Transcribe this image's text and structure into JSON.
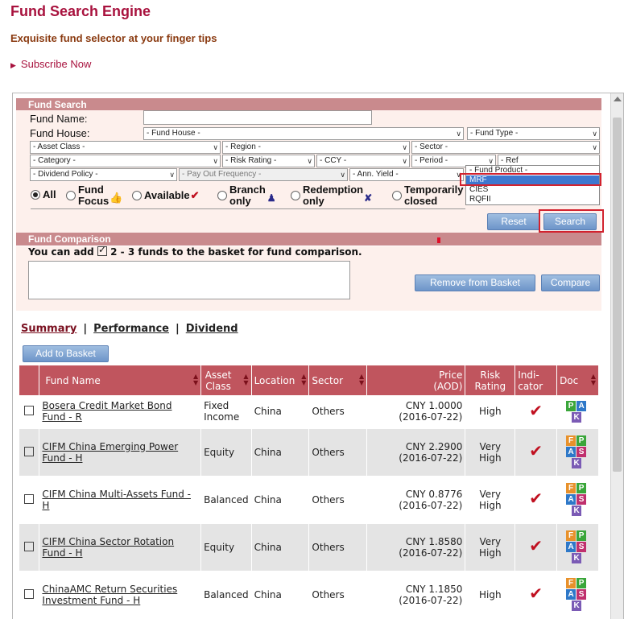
{
  "header": {
    "title": "Fund Search Engine",
    "subtitle": "Exquisite fund selector at your finger tips",
    "subscribe": "Subscribe Now"
  },
  "fund_search": {
    "heading": "Fund Search",
    "fund_name_label": "Fund Name:",
    "fund_house_label": "Fund House:",
    "fund_house_select": "- Fund House -",
    "fund_type_select": "- Fund Type -",
    "asset_class_select": "- Asset Class -",
    "region_select": "- Region -",
    "sector_select": "- Sector -",
    "category_select": "- Category -",
    "risk_rating_select": "- Risk Rating -",
    "ccy_select": "- CCY -",
    "period_select": "- Period -",
    "ref_select": "- Ref",
    "dividend_policy_select": "- Dividend Policy -",
    "payout_frequency_select": "- Pay Out Frequency -",
    "ann_yield_select": "- Ann. Yield -",
    "fund_product_dropdown": {
      "options": [
        "- Fund Product -",
        "MRF",
        "CIES",
        "RQFII"
      ],
      "highlighted": "MRF"
    },
    "radio_options": [
      {
        "label_line1": "All",
        "label_line2": "",
        "selected": true
      },
      {
        "label_line1": "Fund",
        "label_line2": "Focus",
        "selected": false
      },
      {
        "label_line1": "Available",
        "label_line2": "",
        "selected": false
      },
      {
        "label_line1": "Branch",
        "label_line2": "only",
        "selected": false
      },
      {
        "label_line1": "Redemption",
        "label_line2": "only",
        "selected": false
      },
      {
        "label_line1": "Temporarily",
        "label_line2": "closed",
        "selected": false
      }
    ],
    "reset_label": "Reset",
    "search_label": "Search"
  },
  "fund_comparison": {
    "heading": "Fund Comparison",
    "note_prefix": "You can add",
    "note_suffix": "2 - 3 funds to the basket for fund comparison.",
    "remove_label": "Remove from Basket",
    "compare_label": "Compare"
  },
  "tabs": [
    "Summary",
    "Performance",
    "Dividend"
  ],
  "add_to_basket_label": "Add to Basket",
  "table": {
    "headers": {
      "fund_name": "Fund Name",
      "asset_class": "Asset Class",
      "location": "Location",
      "sector": "Sector",
      "price_line1": "Price",
      "price_line2": "(AOD)",
      "risk_line1": "Risk",
      "risk_line2": "Rating",
      "indicator_line1": "Indi-",
      "indicator_line2": "cator",
      "doc": "Doc"
    },
    "rows": [
      {
        "name": "Bosera Credit Market Bond Fund - R",
        "asset_class": "Fixed Income",
        "location": "China",
        "sector": "Others",
        "price": "CNY 1.0000",
        "date": "(2016-07-22)",
        "risk": "High",
        "docs": [
          "P",
          "A",
          "K"
        ]
      },
      {
        "name": "CIFM China Emerging Power Fund - H",
        "asset_class": "Equity",
        "location": "China",
        "sector": "Others",
        "price": "CNY 2.2900",
        "date": "(2016-07-22)",
        "risk": "Very High",
        "docs": [
          "F",
          "P",
          "A",
          "S",
          "K"
        ]
      },
      {
        "name": "CIFM China Multi-Assets Fund - H",
        "asset_class": "Balanced",
        "location": "China",
        "sector": "Others",
        "price": "CNY 0.8776",
        "date": "(2016-07-22)",
        "risk": "Very High",
        "docs": [
          "F",
          "P",
          "A",
          "S",
          "K"
        ]
      },
      {
        "name": "CIFM China Sector Rotation Fund - H",
        "asset_class": "Equity",
        "location": "China",
        "sector": "Others",
        "price": "CNY 1.8580",
        "date": "(2016-07-22)",
        "risk": "Very High",
        "docs": [
          "F",
          "P",
          "A",
          "S",
          "K"
        ]
      },
      {
        "name": "ChinaAMC Return Securities Investment Fund - H",
        "asset_class": "Balanced",
        "location": "China",
        "sector": "Others",
        "price": "CNY 1.1850",
        "date": "(2016-07-22)",
        "risk": "High",
        "docs": [
          "F",
          "P",
          "A",
          "S",
          "K"
        ]
      }
    ]
  }
}
